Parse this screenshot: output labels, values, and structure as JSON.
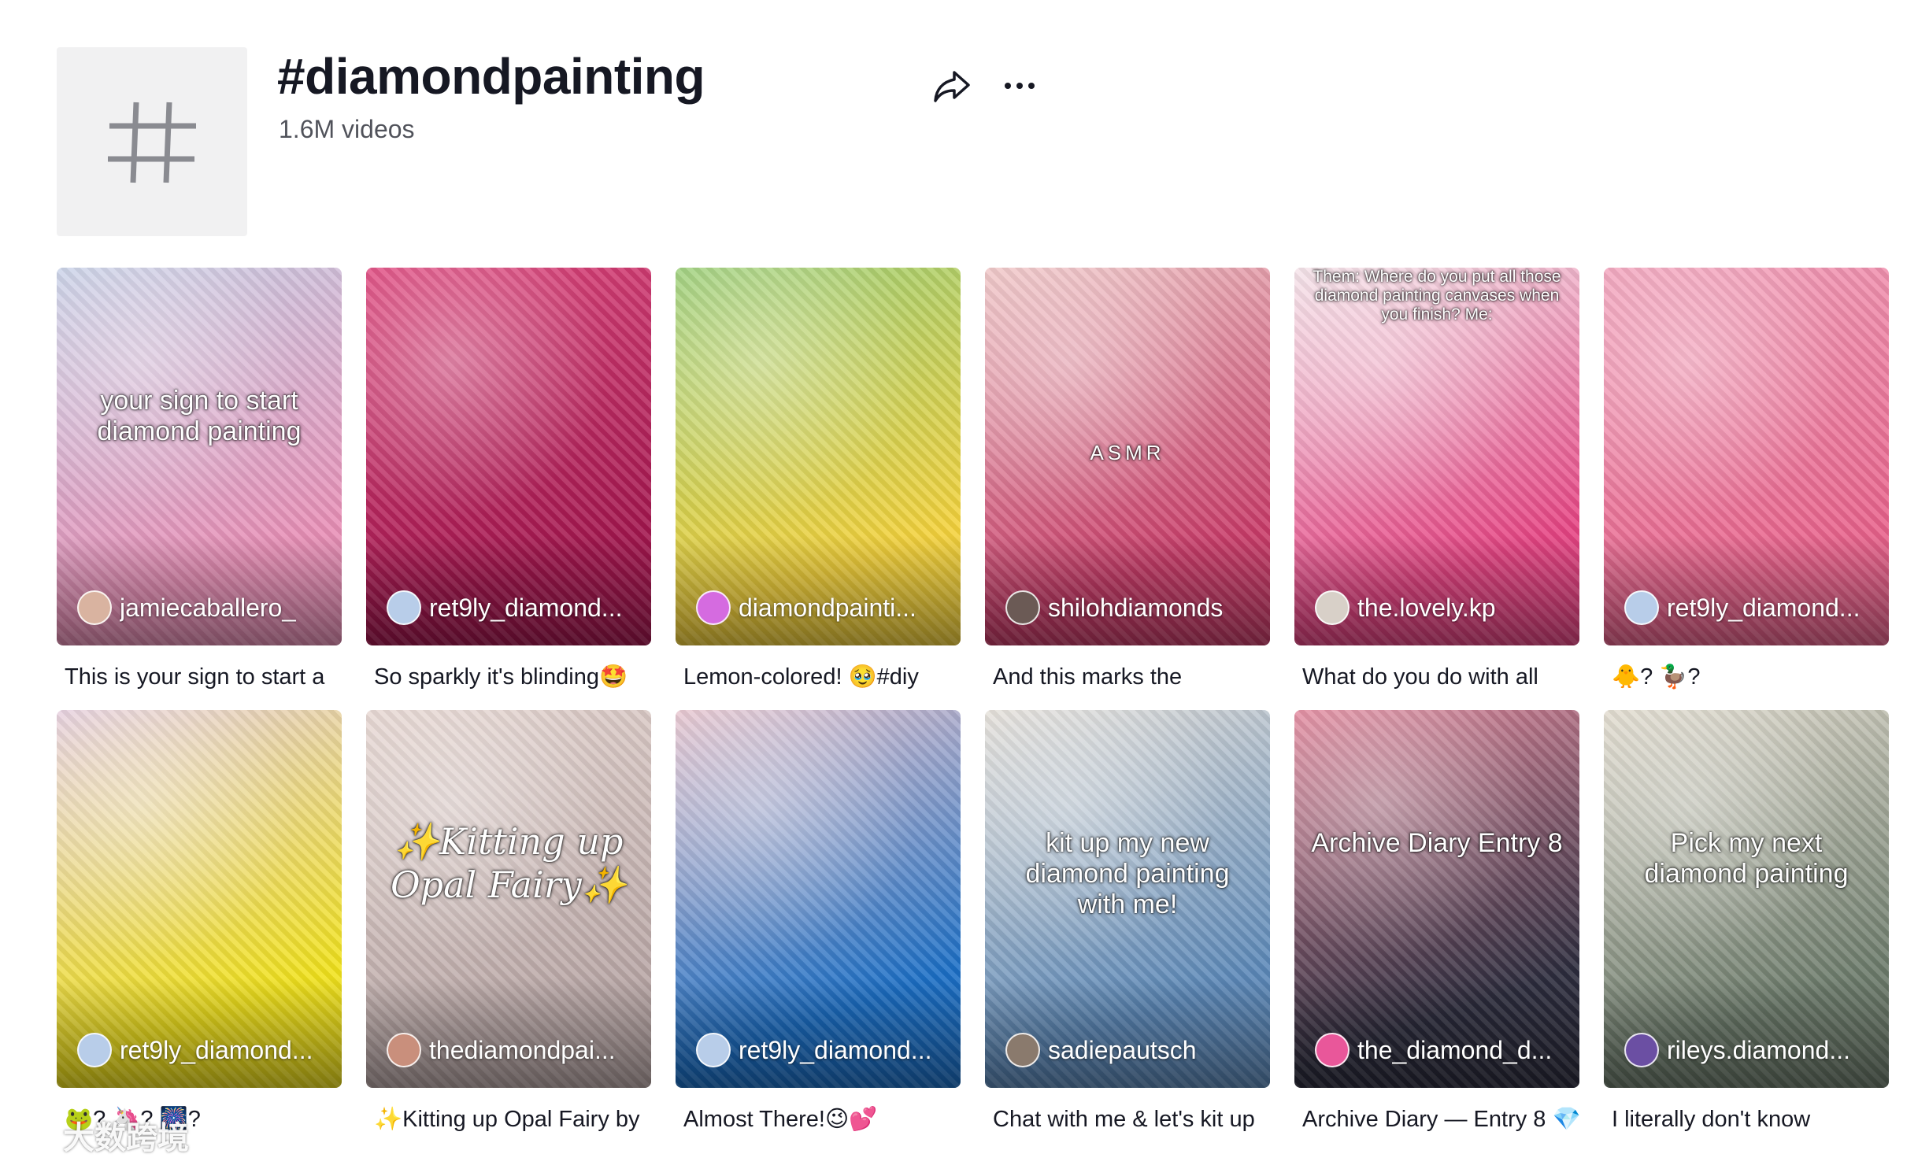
{
  "header": {
    "tag_symbol": "#",
    "title": "#diamondpainting",
    "video_count": "1.6M videos"
  },
  "videos": [
    {
      "author": "jamiecaballero_",
      "caption": "This is your sign to start a",
      "overlay": "your sign to start diamond painting",
      "colors": {
        "bg1": "#e88fb6",
        "bg2": "#c9d2e8",
        "avatar": "#d9b3a0"
      }
    },
    {
      "author": "ret9ly_diamond...",
      "caption": "So sparkly it's blinding🤩",
      "overlay": "",
      "colors": {
        "bg1": "#a3164e",
        "bg2": "#e0497f",
        "avatar": "#b8cde9"
      }
    },
    {
      "author": "diamondpainti...",
      "caption": "Lemon-colored! 🥹#diy",
      "overlay": "",
      "colors": {
        "bg1": "#f4d23c",
        "bg2": "#9bcf7a",
        "avatar": "#d56be0"
      }
    },
    {
      "author": "shilohdiamonds",
      "caption": "And this marks the",
      "overlay": "ASMR",
      "colors": {
        "bg1": "#c93c69",
        "bg2": "#f0c7c7",
        "avatar": "#6b5a55"
      }
    },
    {
      "author": "the.lovely.kp",
      "caption": "What do you do with all",
      "overlay": "Them: Where do you put all those diamond painting canvases when you finish? Me:",
      "colors": {
        "bg1": "#e64483",
        "bg2": "#f5e4ea",
        "avatar": "#d8d0c8"
      }
    },
    {
      "author": "ret9ly_diamond...",
      "caption": "🐥? 🦆?",
      "overlay": "",
      "colors": {
        "bg1": "#e8628b",
        "bg2": "#f3a4bd",
        "avatar": "#b8cde9"
      }
    },
    {
      "author": "ret9ly_diamond...",
      "caption": "🐸? 🦄? 🎆?",
      "overlay": "",
      "colors": {
        "bg1": "#f1e21c",
        "bg2": "#e6cfe0",
        "avatar": "#b8cde9"
      }
    },
    {
      "author": "thediamondpai...",
      "caption": "✨Kitting up Opal Fairy by",
      "overlay": "✨Kitting up Opal Fairy✨",
      "colors": {
        "bg1": "#b9a7a6",
        "bg2": "#e7d7d2",
        "avatar": "#c98f7c"
      }
    },
    {
      "author": "ret9ly_diamond...",
      "caption": "Almost There!😉💕",
      "overlay": "",
      "colors": {
        "bg1": "#1b6fc6",
        "bg2": "#e9c6cf",
        "avatar": "#b8cde9"
      }
    },
    {
      "author": "sadiepautsch",
      "caption": "Chat with me & let's kit up",
      "overlay": "kit up my new diamond painting with me!",
      "colors": {
        "bg1": "#5b88b8",
        "bg2": "#e6e1da",
        "avatar": "#8a7a6d"
      }
    },
    {
      "author": "the_diamond_d...",
      "caption": "Archive Diary — Entry 8 💎",
      "overlay": "Archive Diary Entry 8",
      "colors": {
        "bg1": "#2c2c3d",
        "bg2": "#e48a9f",
        "avatar": "#e9579a"
      }
    },
    {
      "author": "rileys.diamond...",
      "caption": "I literally don't know",
      "overlay": "Pick my next diamond painting",
      "colors": {
        "bg1": "#6b7a6a",
        "bg2": "#e2dccf",
        "avatar": "#6b4fa3"
      }
    }
  ],
  "watermark": "大数跨境"
}
